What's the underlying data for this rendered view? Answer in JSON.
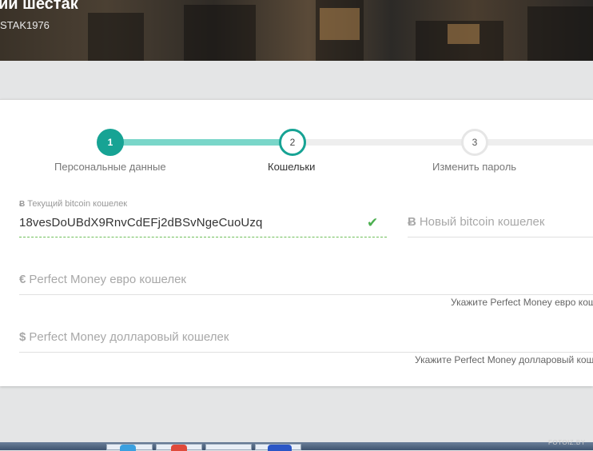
{
  "profile": {
    "name": "ий шестак",
    "login": "STAK1976"
  },
  "stepper": {
    "steps": [
      {
        "number": "1",
        "label": "Персональные данные",
        "state": "completed"
      },
      {
        "number": "2",
        "label": "Кошельки",
        "state": "active"
      },
      {
        "number": "3",
        "label": "Изменить пароль",
        "state": "pending"
      }
    ],
    "accent_color": "#17a394",
    "progress_color": "#79d6c9"
  },
  "wallets": {
    "current_bitcoin": {
      "currency_symbol": "Ƀ",
      "label": "Текущий bitcoin кошелек",
      "value": "18vesDoUBdX9RnvCdEFj2dBSvNgeCuoUzq",
      "status": "valid"
    },
    "new_bitcoin": {
      "currency_symbol": "Ƀ",
      "placeholder": "Новый bitcoin кошелек"
    },
    "pm_euro": {
      "currency_symbol": "€",
      "placeholder": "Perfect Money евро кошелек",
      "hint": "Укажите Perfect Money евро кош"
    },
    "pm_dollar": {
      "currency_symbol": "$",
      "placeholder": "Perfect Money долларовый кошелек",
      "hint": "Укажите Perfect Money долларовый кош"
    }
  },
  "watermark": "FOTOIZ.BY",
  "colors": {
    "valid": "#4caf50",
    "background": "#e4e5e6"
  }
}
